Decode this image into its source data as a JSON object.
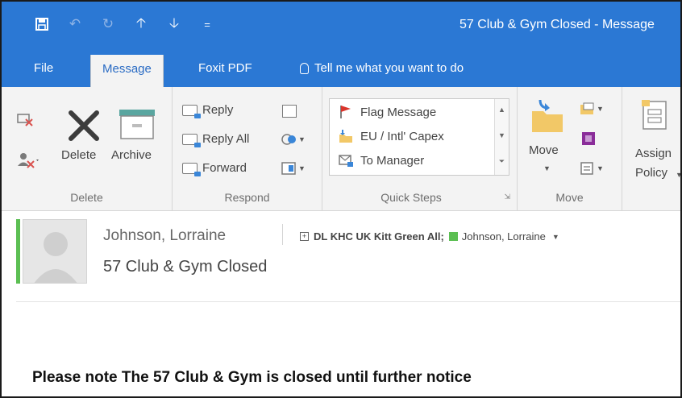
{
  "window": {
    "title": "57 Club & Gym Closed  -  Message"
  },
  "qat": {
    "icons": [
      "save-icon",
      "undo-icon",
      "redo-icon",
      "up-arrow-icon",
      "down-arrow-icon",
      "customize-icon"
    ]
  },
  "tabs": [
    {
      "label": "File"
    },
    {
      "label": "Message",
      "active": true
    },
    {
      "label": "Foxit PDF"
    },
    {
      "label": "Tell me what you want to do"
    }
  ],
  "ribbon": {
    "delete_group": {
      "label": "Delete",
      "delete_label": "Delete",
      "archive_label": "Archive"
    },
    "respond_group": {
      "label": "Respond",
      "reply_label": "Reply",
      "reply_all_label": "Reply All",
      "forward_label": "Forward"
    },
    "quick_steps_group": {
      "label": "Quick Steps",
      "items": [
        {
          "label": "Flag Message",
          "icon": "flag-icon"
        },
        {
          "label": "EU / Intl' Capex",
          "icon": "folder-move-icon"
        },
        {
          "label": "To Manager",
          "icon": "envelope-forward-icon"
        }
      ]
    },
    "move_group": {
      "label": "Move",
      "move_label": "Move"
    },
    "tags_group": {
      "assign_label": "Assign",
      "policy_label": "Policy"
    }
  },
  "message": {
    "sender": "Johnson, Lorraine",
    "recipients_group": "DL KHC UK Kitt Green All;",
    "recipient_person": "Johnson, Lorraine",
    "subject": "57 Club & Gym Closed",
    "body": "Please note The 57 Club & Gym is closed until further notice"
  },
  "colors": {
    "title_bar": "#2b78d4",
    "ribbon_bg": "#f3f3f3",
    "presence_green": "#5cbf53",
    "active_tab_text": "#2b6cc4"
  }
}
